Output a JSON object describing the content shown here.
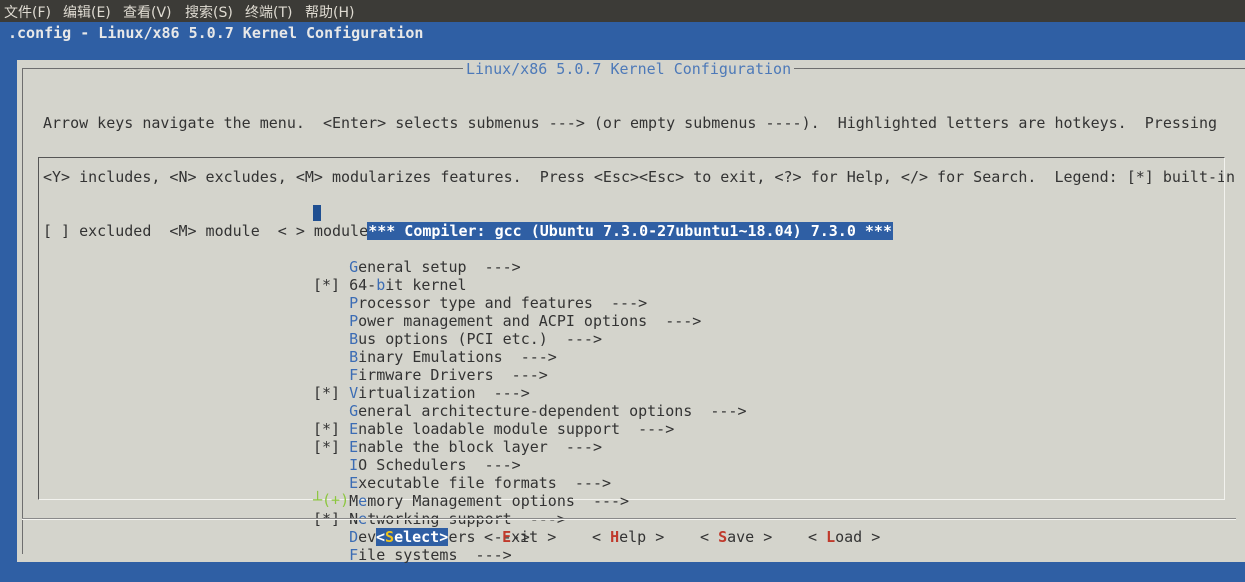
{
  "menubar": {
    "file": "文件(F)",
    "edit": "编辑(E)",
    "view": "查看(V)",
    "search": "搜索(S)",
    "terminal": "终端(T)",
    "help": "帮助(H)"
  },
  "window_title": ".config - Linux/x86 5.0.7 Kernel Configuration",
  "dialog_title": "Linux/x86 5.0.7 Kernel Configuration",
  "help_lines": [
    "Arrow keys navigate the menu.  <Enter> selects submenus ---> (or empty submenus ----).  Highlighted letters are hotkeys.  Pressing",
    "<Y> includes, <N> excludes, <M> modularizes features.  Press <Esc><Esc> to exit, <?> for Help, </> for Search.  Legend: [*] built-in",
    "[ ] excluded  <M> module  < > module capable"
  ],
  "selected_item": "*** Compiler: gcc (Ubuntu 7.3.0-27ubuntu1~18.04) 7.3.0 ***",
  "menu_items": [
    {
      "prefix": "    ",
      "hotkey": "G",
      "rest": "eneral setup  --->"
    },
    {
      "prefix": "[*] ",
      "pre": "64-",
      "hotkey": "b",
      "rest": "it kernel"
    },
    {
      "prefix": "    ",
      "hotkey": "P",
      "rest": "rocessor type and features  --->"
    },
    {
      "prefix": "    ",
      "hotkey": "P",
      "rest": "ower management and ACPI options  --->"
    },
    {
      "prefix": "    ",
      "hotkey": "B",
      "rest": "us options (PCI etc.)  --->"
    },
    {
      "prefix": "    ",
      "hotkey": "B",
      "rest": "inary Emulations  --->"
    },
    {
      "prefix": "    ",
      "hotkey": "F",
      "rest": "irmware Drivers  --->"
    },
    {
      "prefix": "[*] ",
      "hotkey": "V",
      "rest": "irtualization  --->"
    },
    {
      "prefix": "    ",
      "hotkey": "G",
      "rest": "eneral architecture-dependent options  --->"
    },
    {
      "prefix": "[*] ",
      "hotkey": "E",
      "rest": "nable loadable module support  --->"
    },
    {
      "prefix": "[*] ",
      "hotkey": "E",
      "rest": "nable the block layer  --->"
    },
    {
      "prefix": "    ",
      "hotkey": "I",
      "rest": "O Schedulers  --->"
    },
    {
      "prefix": "    ",
      "hotkey": "E",
      "rest": "xecutable file formats  --->"
    },
    {
      "prefix": "    ",
      "pre": "M",
      "hotkey": "e",
      "rest": "mory Management options  --->"
    },
    {
      "prefix": "[*] ",
      "pre": "N",
      "hotkey": "e",
      "rest": "tworking support  --->"
    },
    {
      "prefix": "    ",
      "hotkey": "D",
      "rest": "evice Drivers  --->"
    },
    {
      "prefix": "    ",
      "hotkey": "F",
      "rest": "ile systems  --->"
    }
  ],
  "more_indicator": "┴(+)",
  "buttons": {
    "select": {
      "pre": "<",
      "hotkey": "S",
      "rest": "elect>"
    },
    "exit": {
      "pre": "< ",
      "hotkey": "E",
      "rest": "xit >"
    },
    "help": {
      "pre": "< ",
      "hotkey": "H",
      "rest": "elp >"
    },
    "save": {
      "pre": "< ",
      "hotkey": "S",
      "rest": "ave >"
    },
    "load": {
      "pre": "< ",
      "hotkey": "L",
      "rest": "oad >"
    }
  },
  "colors": {
    "terminal_blue": "#2f5fa4",
    "dialog_bg": "#d4d4cc",
    "hotkey_blue": "#3b6cb4",
    "button_hotkey_red": "#c0392b",
    "more_green": "#8cc63f"
  }
}
